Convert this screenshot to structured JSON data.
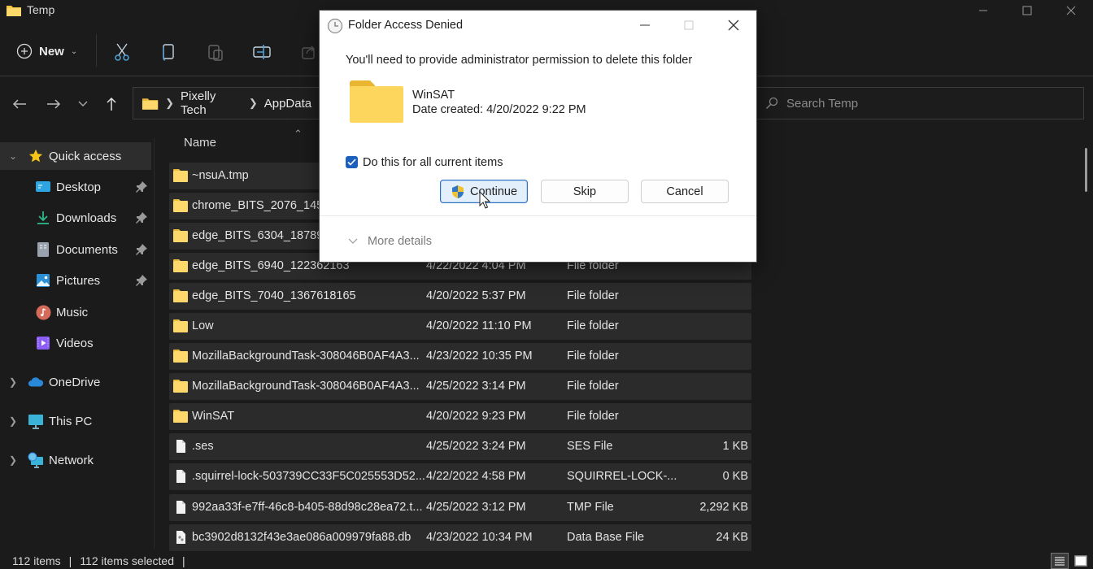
{
  "window": {
    "title": "Temp",
    "controls": [
      "minimize",
      "maximize",
      "close"
    ]
  },
  "toolbar": {
    "new_label": "New",
    "buttons": [
      "cut",
      "copy",
      "paste",
      "rename",
      "share"
    ]
  },
  "address": {
    "segments": [
      "Pixelly Tech",
      "AppData"
    ]
  },
  "search": {
    "placeholder": "Search Temp"
  },
  "sidebar": {
    "items": [
      {
        "label": "Quick access",
        "icon": "star-icon",
        "expandable": true,
        "active": true
      },
      {
        "label": "Desktop",
        "icon": "desktop-icon",
        "pinned": true
      },
      {
        "label": "Downloads",
        "icon": "download-icon",
        "pinned": true
      },
      {
        "label": "Documents",
        "icon": "documents-icon",
        "pinned": true
      },
      {
        "label": "Pictures",
        "icon": "pictures-icon",
        "pinned": true
      },
      {
        "label": "Music",
        "icon": "music-icon"
      },
      {
        "label": "Videos",
        "icon": "videos-icon"
      },
      {
        "label": "OneDrive",
        "icon": "cloud-icon",
        "expandable": true
      },
      {
        "label": "This PC",
        "icon": "monitor-icon",
        "expandable": true
      },
      {
        "label": "Network",
        "icon": "network-icon",
        "expandable": true
      }
    ]
  },
  "file_list": {
    "column_name": "Name",
    "rows": [
      {
        "name": "~nsuA.tmp",
        "date": "",
        "type": "",
        "size": "",
        "kind": "folder"
      },
      {
        "name": "chrome_BITS_2076_14540",
        "date": "",
        "type": "",
        "size": "",
        "kind": "folder"
      },
      {
        "name": "edge_BITS_6304_18789011",
        "date": "",
        "type": "",
        "size": "",
        "kind": "folder"
      },
      {
        "name": "edge_BITS_6940_122362163",
        "date": "4/22/2022 4:04 PM",
        "type": "File folder",
        "size": "",
        "kind": "folder"
      },
      {
        "name": "edge_BITS_7040_1367618165",
        "date": "4/20/2022 5:37 PM",
        "type": "File folder",
        "size": "",
        "kind": "folder"
      },
      {
        "name": "Low",
        "date": "4/20/2022 11:10 PM",
        "type": "File folder",
        "size": "",
        "kind": "folder"
      },
      {
        "name": "MozillaBackgroundTask-308046B0AF4A3...",
        "date": "4/23/2022 10:35 PM",
        "type": "File folder",
        "size": "",
        "kind": "folder"
      },
      {
        "name": "MozillaBackgroundTask-308046B0AF4A3...",
        "date": "4/25/2022 3:14 PM",
        "type": "File folder",
        "size": "",
        "kind": "folder"
      },
      {
        "name": "WinSAT",
        "date": "4/20/2022 9:23 PM",
        "type": "File folder",
        "size": "",
        "kind": "folder"
      },
      {
        "name": ".ses",
        "date": "4/25/2022 3:24 PM",
        "type": "SES File",
        "size": "1 KB",
        "kind": "file"
      },
      {
        "name": ".squirrel-lock-503739CC33F5C025553D52...",
        "date": "4/22/2022 4:58 PM",
        "type": "SQUIRREL-LOCK-...",
        "size": "0 KB",
        "kind": "file"
      },
      {
        "name": "992aa33f-e7ff-46c8-b405-88d98c28ea72.t...",
        "date": "4/25/2022 3:12 PM",
        "type": "TMP File",
        "size": "2,292 KB",
        "kind": "file"
      },
      {
        "name": "bc3902d8132f43e3ae086a009979fa88.db",
        "date": "4/23/2022 10:34 PM",
        "type": "Data Base File",
        "size": "24 KB",
        "kind": "db"
      }
    ]
  },
  "status": {
    "items_count": "112 items",
    "selected_count": "112 items selected"
  },
  "dialog": {
    "title": "Folder Access Denied",
    "message": "You'll need to provide administrator permission to delete this folder",
    "folder_name": "WinSAT",
    "date_created": "Date created: 4/20/2022 9:22 PM",
    "checkbox_label": "Do this for all current items",
    "checkbox_checked": true,
    "continue_label": "Continue",
    "skip_label": "Skip",
    "cancel_label": "Cancel",
    "more_details_label": "More details"
  }
}
